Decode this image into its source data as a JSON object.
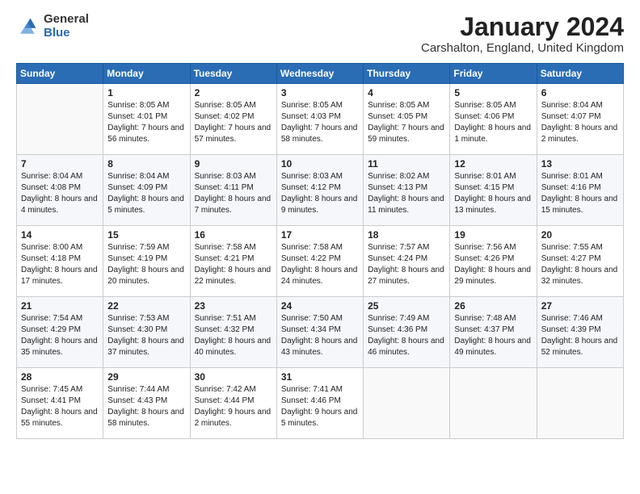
{
  "logo": {
    "general": "General",
    "blue": "Blue"
  },
  "header": {
    "title": "January 2024",
    "location": "Carshalton, England, United Kingdom"
  },
  "days_of_week": [
    "Sunday",
    "Monday",
    "Tuesday",
    "Wednesday",
    "Thursday",
    "Friday",
    "Saturday"
  ],
  "weeks": [
    [
      {
        "day": "",
        "info": ""
      },
      {
        "day": "1",
        "info": "Sunrise: 8:05 AM\nSunset: 4:01 PM\nDaylight: 7 hours\nand 56 minutes."
      },
      {
        "day": "2",
        "info": "Sunrise: 8:05 AM\nSunset: 4:02 PM\nDaylight: 7 hours\nand 57 minutes."
      },
      {
        "day": "3",
        "info": "Sunrise: 8:05 AM\nSunset: 4:03 PM\nDaylight: 7 hours\nand 58 minutes."
      },
      {
        "day": "4",
        "info": "Sunrise: 8:05 AM\nSunset: 4:05 PM\nDaylight: 7 hours\nand 59 minutes."
      },
      {
        "day": "5",
        "info": "Sunrise: 8:05 AM\nSunset: 4:06 PM\nDaylight: 8 hours\nand 1 minute."
      },
      {
        "day": "6",
        "info": "Sunrise: 8:04 AM\nSunset: 4:07 PM\nDaylight: 8 hours\nand 2 minutes."
      }
    ],
    [
      {
        "day": "7",
        "info": "Sunrise: 8:04 AM\nSunset: 4:08 PM\nDaylight: 8 hours\nand 4 minutes."
      },
      {
        "day": "8",
        "info": "Sunrise: 8:04 AM\nSunset: 4:09 PM\nDaylight: 8 hours\nand 5 minutes."
      },
      {
        "day": "9",
        "info": "Sunrise: 8:03 AM\nSunset: 4:11 PM\nDaylight: 8 hours\nand 7 minutes."
      },
      {
        "day": "10",
        "info": "Sunrise: 8:03 AM\nSunset: 4:12 PM\nDaylight: 8 hours\nand 9 minutes."
      },
      {
        "day": "11",
        "info": "Sunrise: 8:02 AM\nSunset: 4:13 PM\nDaylight: 8 hours\nand 11 minutes."
      },
      {
        "day": "12",
        "info": "Sunrise: 8:01 AM\nSunset: 4:15 PM\nDaylight: 8 hours\nand 13 minutes."
      },
      {
        "day": "13",
        "info": "Sunrise: 8:01 AM\nSunset: 4:16 PM\nDaylight: 8 hours\nand 15 minutes."
      }
    ],
    [
      {
        "day": "14",
        "info": "Sunrise: 8:00 AM\nSunset: 4:18 PM\nDaylight: 8 hours\nand 17 minutes."
      },
      {
        "day": "15",
        "info": "Sunrise: 7:59 AM\nSunset: 4:19 PM\nDaylight: 8 hours\nand 20 minutes."
      },
      {
        "day": "16",
        "info": "Sunrise: 7:58 AM\nSunset: 4:21 PM\nDaylight: 8 hours\nand 22 minutes."
      },
      {
        "day": "17",
        "info": "Sunrise: 7:58 AM\nSunset: 4:22 PM\nDaylight: 8 hours\nand 24 minutes."
      },
      {
        "day": "18",
        "info": "Sunrise: 7:57 AM\nSunset: 4:24 PM\nDaylight: 8 hours\nand 27 minutes."
      },
      {
        "day": "19",
        "info": "Sunrise: 7:56 AM\nSunset: 4:26 PM\nDaylight: 8 hours\nand 29 minutes."
      },
      {
        "day": "20",
        "info": "Sunrise: 7:55 AM\nSunset: 4:27 PM\nDaylight: 8 hours\nand 32 minutes."
      }
    ],
    [
      {
        "day": "21",
        "info": "Sunrise: 7:54 AM\nSunset: 4:29 PM\nDaylight: 8 hours\nand 35 minutes."
      },
      {
        "day": "22",
        "info": "Sunrise: 7:53 AM\nSunset: 4:30 PM\nDaylight: 8 hours\nand 37 minutes."
      },
      {
        "day": "23",
        "info": "Sunrise: 7:51 AM\nSunset: 4:32 PM\nDaylight: 8 hours\nand 40 minutes."
      },
      {
        "day": "24",
        "info": "Sunrise: 7:50 AM\nSunset: 4:34 PM\nDaylight: 8 hours\nand 43 minutes."
      },
      {
        "day": "25",
        "info": "Sunrise: 7:49 AM\nSunset: 4:36 PM\nDaylight: 8 hours\nand 46 minutes."
      },
      {
        "day": "26",
        "info": "Sunrise: 7:48 AM\nSunset: 4:37 PM\nDaylight: 8 hours\nand 49 minutes."
      },
      {
        "day": "27",
        "info": "Sunrise: 7:46 AM\nSunset: 4:39 PM\nDaylight: 8 hours\nand 52 minutes."
      }
    ],
    [
      {
        "day": "28",
        "info": "Sunrise: 7:45 AM\nSunset: 4:41 PM\nDaylight: 8 hours\nand 55 minutes."
      },
      {
        "day": "29",
        "info": "Sunrise: 7:44 AM\nSunset: 4:43 PM\nDaylight: 8 hours\nand 58 minutes."
      },
      {
        "day": "30",
        "info": "Sunrise: 7:42 AM\nSunset: 4:44 PM\nDaylight: 9 hours\nand 2 minutes."
      },
      {
        "day": "31",
        "info": "Sunrise: 7:41 AM\nSunset: 4:46 PM\nDaylight: 9 hours\nand 5 minutes."
      },
      {
        "day": "",
        "info": ""
      },
      {
        "day": "",
        "info": ""
      },
      {
        "day": "",
        "info": ""
      }
    ]
  ]
}
